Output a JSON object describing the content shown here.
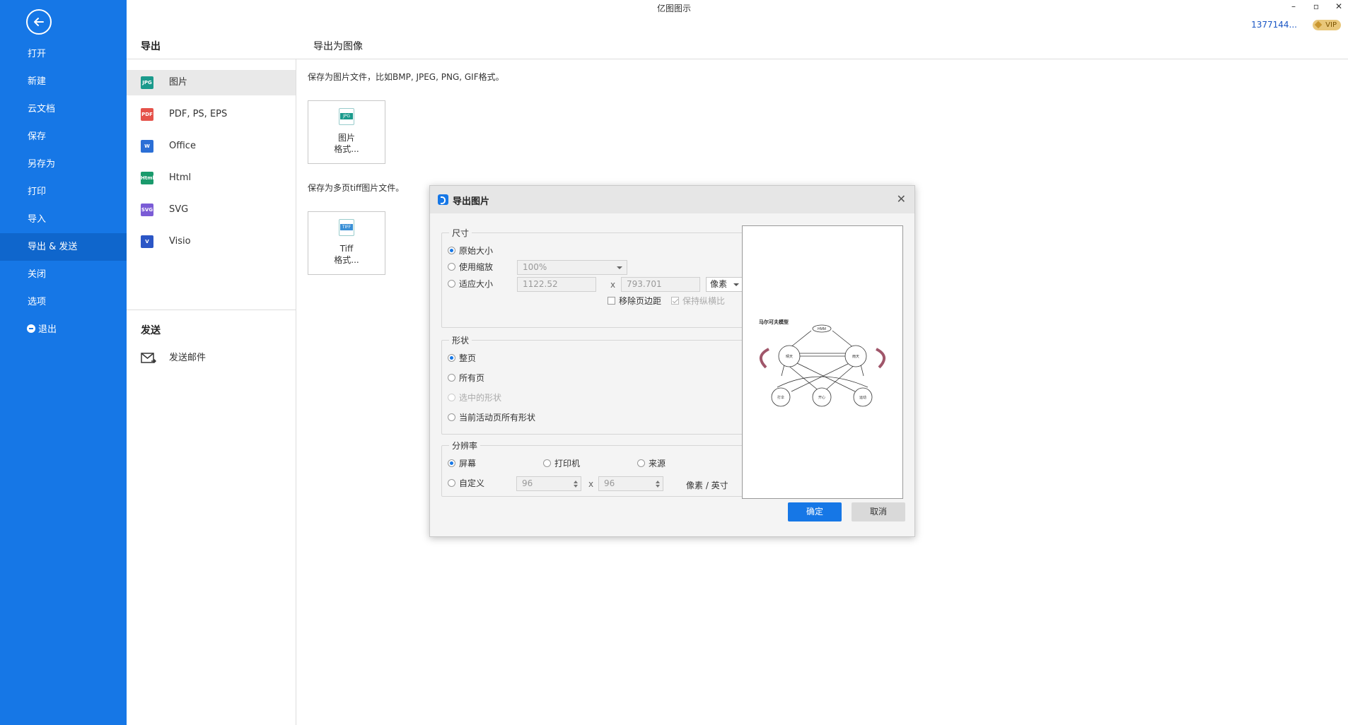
{
  "window": {
    "title": "亿图图示",
    "minimize": "–",
    "restore": "▫",
    "close": "✕",
    "user_id": "1377144...",
    "vip": "VIP"
  },
  "sidebar": {
    "items": [
      {
        "label": "打开"
      },
      {
        "label": "新建"
      },
      {
        "label": "云文档"
      },
      {
        "label": "保存"
      },
      {
        "label": "另存为"
      },
      {
        "label": "打印"
      },
      {
        "label": "导入"
      },
      {
        "label": "导出 & 发送",
        "active": true
      },
      {
        "label": "关闭"
      },
      {
        "label": "选项"
      },
      {
        "label": "退出"
      }
    ]
  },
  "export_panel": {
    "heading": "导出",
    "formats": [
      {
        "label": "图片",
        "icon": "jpg-file-icon",
        "badge": "JPG",
        "color": "#1a9a8c",
        "active": true
      },
      {
        "label": "PDF, PS, EPS",
        "icon": "pdf-file-icon",
        "badge": "PDF",
        "color": "#e5524a"
      },
      {
        "label": "Office",
        "icon": "word-file-icon",
        "badge": "W",
        "color": "#2b6fd6"
      },
      {
        "label": "Html",
        "icon": "html-file-icon",
        "badge": "Html",
        "color": "#1a9a6c"
      },
      {
        "label": "SVG",
        "icon": "svg-file-icon",
        "badge": "SVG",
        "color": "#7b5cd6"
      },
      {
        "label": "Visio",
        "icon": "visio-file-icon",
        "badge": "V",
        "color": "#2b56c6"
      }
    ],
    "send_heading": "发送",
    "send_mail": "发送邮件"
  },
  "main": {
    "title": "导出为图像",
    "image_desc": "保存为图片文件，比如BMP, JPEG, PNG, GIF格式。",
    "image_tile": {
      "line1": "图片",
      "line2": "格式...",
      "badge": "JPG"
    },
    "tiff_desc": "保存为多页tiff图片文件。",
    "tiff_tile": {
      "line1": "Tiff",
      "line2": "格式...",
      "badge": "TIFF"
    }
  },
  "dialog": {
    "title": "导出图片",
    "close": "✕",
    "size_group": {
      "label": "尺寸",
      "original": "原始大小",
      "use_zoom": "使用缩放",
      "zoom_value": "100%",
      "fit_size": "适应大小",
      "width": "1122.52",
      "height": "793.701",
      "x": "x",
      "unit": "像素",
      "remove_margin": "移除页边距",
      "keep_ratio": "保持纵横比"
    },
    "shape_group": {
      "label": "形状",
      "whole_page": "整页",
      "all_pages": "所有页",
      "selected_shapes": "选中的形状",
      "current_page_all": "当前活动页所有形状"
    },
    "resolution_group": {
      "label": "分辨率",
      "screen": "屏幕",
      "printer": "打印机",
      "source": "来源",
      "custom": "自定义",
      "dpi_x": "96",
      "dpi_y": "96",
      "x": "x",
      "unit": "像素 / 英寸"
    },
    "preview": {
      "title": "马尔可夫模型",
      "nodes": {
        "top": "HMM",
        "left": "晴天",
        "right": "雨天",
        "b1": "打伞",
        "b2": "开心",
        "b3": "运动"
      }
    },
    "ok": "确定",
    "cancel": "取消"
  }
}
